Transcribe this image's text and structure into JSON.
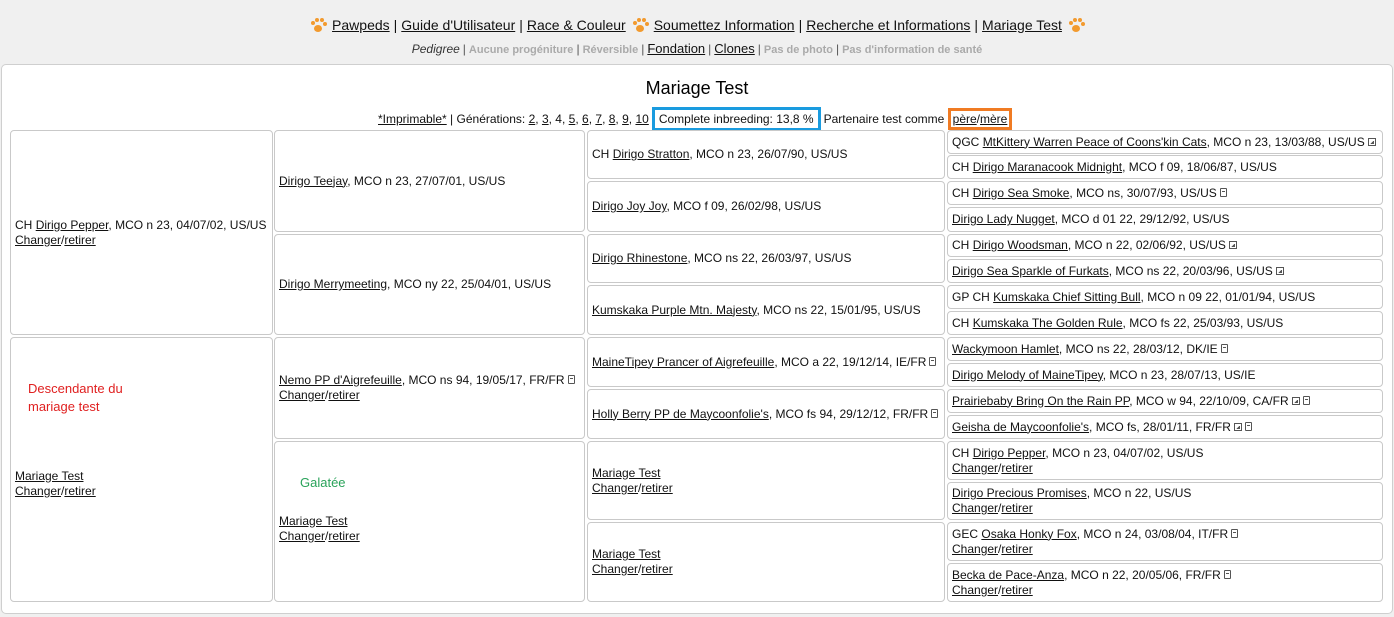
{
  "nav": {
    "links": [
      "Pawpeds",
      "Guide d'Utilisateur",
      "Race & Couleur",
      "Soumettez Information",
      "Recherche et Informations",
      "Mariage Test"
    ],
    "sep": "|"
  },
  "subnav": {
    "pedigree": "Pedigree",
    "no_offspring": "Aucune progéniture",
    "reversible": "Réversible",
    "foundation": "Fondation",
    "clones": "Clones",
    "no_photo": "Pas de photo",
    "no_health": "Pas d'information de santé"
  },
  "title": "Mariage Test",
  "options": {
    "printable": "*Imprimable*",
    "generations_label": "Générations:",
    "gen": [
      "2",
      "3",
      "4",
      "5",
      "6",
      "7",
      "8",
      "9",
      "10"
    ],
    "inbreeding": "Complete inbreeding: 13,8 %",
    "partner_label": "Partenaire test comme",
    "father": "père",
    "mother": "mère"
  },
  "common": {
    "change": "Changer",
    "remove": "retirer",
    "slash": "/"
  },
  "annotations": {
    "offspring": "Descendante du mariage test",
    "galatee": "Galatée"
  },
  "gen1": [
    {
      "prefix": "CH",
      "name": "Dirigo Pepper",
      "info": ", MCO n 23, 04/07/02, US/US"
    },
    {
      "prefix": "",
      "name": "Mariage Test",
      "info": ""
    }
  ],
  "gen2": [
    {
      "prefix": "",
      "name": "Dirigo Teejay",
      "info": ", MCO n 23, 27/07/01, US/US"
    },
    {
      "prefix": "",
      "name": "Dirigo Merrymeeting",
      "info": ", MCO ny 22, 25/04/01, US/US"
    },
    {
      "prefix": "",
      "name": "Nemo PP d'Aigrefeuille",
      "info": ", MCO ns 94, 19/05/17, FR/FR"
    },
    {
      "prefix": "",
      "name": "Mariage Test",
      "info": ""
    }
  ],
  "gen3": [
    {
      "prefix": "CH",
      "name": "Dirigo Stratton",
      "info": ", MCO n 23, 26/07/90, US/US"
    },
    {
      "prefix": "",
      "name": "Dirigo Joy Joy",
      "info": ", MCO f 09, 26/02/98, US/US"
    },
    {
      "prefix": "",
      "name": "Dirigo Rhinestone",
      "info": ", MCO ns 22, 26/03/97, US/US"
    },
    {
      "prefix": "",
      "name": "Kumskaka Purple Mtn. Majesty",
      "info": ", MCO ns 22, 15/01/95, US/US"
    },
    {
      "prefix": "",
      "name": "MaineTipey Prancer of Aigrefeuille",
      "info": ", MCO a 22, 19/12/14, IE/FR"
    },
    {
      "prefix": "",
      "name": "Holly Berry PP de Maycoonfolie's",
      "info": ", MCO fs 94, 29/12/12, FR/FR"
    },
    {
      "prefix": "",
      "name": "Mariage Test",
      "info": ""
    },
    {
      "prefix": "",
      "name": "Mariage Test",
      "info": ""
    }
  ],
  "gen4": [
    {
      "prefix": "QGC",
      "name": "MtKittery Warren Peace of Coons'kin Cats",
      "info": ", MCO n 23, 13/03/88, US/US"
    },
    {
      "prefix": "CH",
      "name": "Dirigo Maranacook Midnight",
      "info": ", MCO f 09, 18/06/87, US/US"
    },
    {
      "prefix": "CH",
      "name": "Dirigo Sea Smoke",
      "info": ", MCO ns, 30/07/93, US/US"
    },
    {
      "prefix": "",
      "name": "Dirigo Lady Nugget",
      "info": ", MCO d 01 22, 29/12/92, US/US"
    },
    {
      "prefix": "CH",
      "name": "Dirigo Woodsman",
      "info": ", MCO n 22, 02/06/92, US/US"
    },
    {
      "prefix": "",
      "name": "Dirigo Sea Sparkle of Furkats",
      "info": ", MCO ns 22, 20/03/96, US/US"
    },
    {
      "prefix": "GP CH",
      "name": "Kumskaka Chief Sitting Bull",
      "info": ", MCO n 09 22, 01/01/94, US/US"
    },
    {
      "prefix": "CH",
      "name": "Kumskaka The Golden Rule",
      "info": ", MCO fs 22, 25/03/93, US/US"
    },
    {
      "prefix": "",
      "name": "Wackymoon Hamlet",
      "info": ", MCO ns 22, 28/03/12, DK/IE"
    },
    {
      "prefix": "",
      "name": "Dirigo Melody of MaineTipey",
      "info": ", MCO n 23, 28/07/13, US/IE"
    },
    {
      "prefix": "",
      "name": "Prairiebaby Bring On the Rain PP",
      "info": ", MCO w 94, 22/10/09, CA/FR"
    },
    {
      "prefix": "",
      "name": "Geisha de Maycoonfolie's",
      "info": ", MCO fs, 28/01/11, FR/FR"
    },
    {
      "prefix": "CH",
      "name": "Dirigo Pepper",
      "info": ", MCO n 23, 04/07/02, US/US"
    },
    {
      "prefix": "",
      "name": "Dirigo Precious Promises",
      "info": ", MCO n 22, US/US"
    },
    {
      "prefix": "GEC",
      "name": "Osaka Honky Fox",
      "info": ", MCO n 24, 03/08/04, IT/FR"
    },
    {
      "prefix": "",
      "name": "Becka de Pace-Anza",
      "info": ", MCO n 22, 20/05/06, FR/FR"
    }
  ]
}
